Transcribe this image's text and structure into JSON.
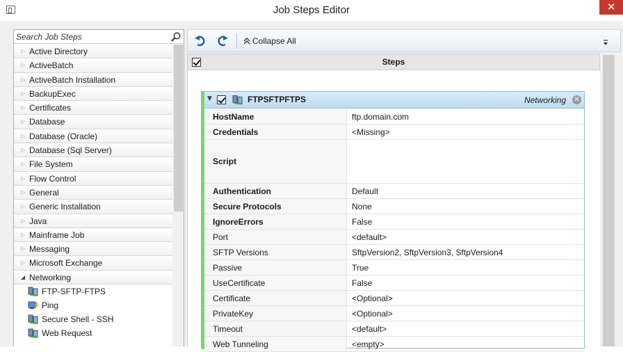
{
  "window": {
    "title": "Job Steps Editor",
    "close_glyph": "✕"
  },
  "search": {
    "placeholder": "Search Job Steps",
    "icon": "search-icon"
  },
  "categories": [
    {
      "label": "Active Directory"
    },
    {
      "label": "ActiveBatch"
    },
    {
      "label": "ActiveBatch Installation"
    },
    {
      "label": "BackupExec"
    },
    {
      "label": "Certificates"
    },
    {
      "label": "Database"
    },
    {
      "label": "Database (Oracle)"
    },
    {
      "label": "Database (Sql Server)"
    },
    {
      "label": "File System"
    },
    {
      "label": "Flow Control"
    },
    {
      "label": "General"
    },
    {
      "label": "Generic Installation"
    },
    {
      "label": "Java"
    },
    {
      "label": "Mainframe Job"
    },
    {
      "label": "Messaging"
    },
    {
      "label": "Microsoft Exchange"
    },
    {
      "label": "Networking",
      "expanded": true
    }
  ],
  "networking_items": [
    {
      "label": "FTP-SFTP-FTPS",
      "icon": "ftp-icon"
    },
    {
      "label": "Ping",
      "icon": "ping-icon"
    },
    {
      "label": "Secure Shell - SSH",
      "icon": "ssh-icon"
    },
    {
      "label": "Web Request",
      "icon": "web-request-icon"
    }
  ],
  "toolbar": {
    "collapse_label": "Collapse All"
  },
  "steps_header": {
    "label": "Steps"
  },
  "step": {
    "name": "FTPSFTPFTPS",
    "category": "Networking",
    "remove_glyph": "✕",
    "properties": [
      {
        "name": "HostName",
        "value": "ftp.domain.com",
        "required": true
      },
      {
        "name": "Credentials",
        "value": "<Missing>",
        "required": true
      },
      {
        "name": "Script",
        "value": "",
        "required": true,
        "tall": true
      },
      {
        "name": "Authentication",
        "value": "Default",
        "required": true
      },
      {
        "name": "Secure Protocols",
        "value": "None",
        "required": true
      },
      {
        "name": "IgnoreErrors",
        "value": "False",
        "required": true
      },
      {
        "name": "Port",
        "value": "<default>",
        "required": false
      },
      {
        "name": "SFTP Versions",
        "value": "SftpVersion2, SftpVersion3, SftpVersion4",
        "required": false
      },
      {
        "name": "Passive",
        "value": "True",
        "required": false
      },
      {
        "name": "UseCertificate",
        "value": "False",
        "required": false
      },
      {
        "name": "Certificate",
        "value": "<Optional>",
        "required": false
      },
      {
        "name": "PrivateKey",
        "value": "<Optional>",
        "required": false
      },
      {
        "name": "Timeout",
        "value": "<default>",
        "required": false
      },
      {
        "name": "Web Tunneling",
        "value": "<empty>",
        "required": false
      }
    ]
  }
}
